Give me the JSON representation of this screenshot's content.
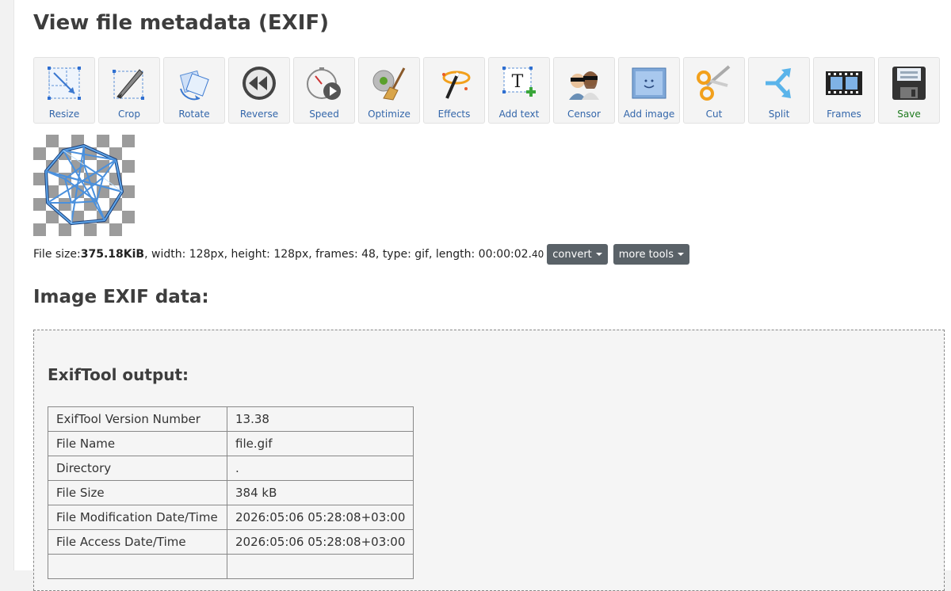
{
  "page": {
    "title": "View file metadata (EXIF)"
  },
  "toolbar": [
    {
      "label": "Resize",
      "icon": "resize-icon"
    },
    {
      "label": "Crop",
      "icon": "crop-icon"
    },
    {
      "label": "Rotate",
      "icon": "rotate-icon"
    },
    {
      "label": "Reverse",
      "icon": "reverse-icon"
    },
    {
      "label": "Speed",
      "icon": "speed-icon"
    },
    {
      "label": "Optimize",
      "icon": "optimize-icon"
    },
    {
      "label": "Effects",
      "icon": "effects-icon"
    },
    {
      "label": "Add text",
      "icon": "add-text-icon"
    },
    {
      "label": "Censor",
      "icon": "censor-icon"
    },
    {
      "label": "Add image",
      "icon": "add-image-icon"
    },
    {
      "label": "Cut",
      "icon": "cut-icon"
    },
    {
      "label": "Split",
      "icon": "split-icon"
    },
    {
      "label": "Frames",
      "icon": "frames-icon"
    },
    {
      "label": "Save",
      "icon": "save-icon"
    }
  ],
  "fileinfo": {
    "size_label": "File size: ",
    "size_value": "375.18KiB",
    "details": ", width: 128px, height: 128px, frames: 48, type: gif, length: 00:00:02.",
    "length_ms": "40",
    "convert_label": "convert",
    "more_tools_label": "more tools"
  },
  "exif": {
    "section_title": "Image EXIF data:",
    "tool_title": "ExifTool output:",
    "rows": [
      {
        "key": "ExifTool Version Number",
        "value": "13.38"
      },
      {
        "key": "File Name",
        "value": "file.gif"
      },
      {
        "key": "Directory",
        "value": "."
      },
      {
        "key": "File Size",
        "value": "384 kB"
      },
      {
        "key": "File Modification Date/Time",
        "value": "2026:05:06 05:28:08+03:00"
      },
      {
        "key": "File Access Date/Time",
        "value": "2026:05:06 05:28:08+03:00"
      },
      {
        "key": "",
        "value": ""
      }
    ]
  }
}
